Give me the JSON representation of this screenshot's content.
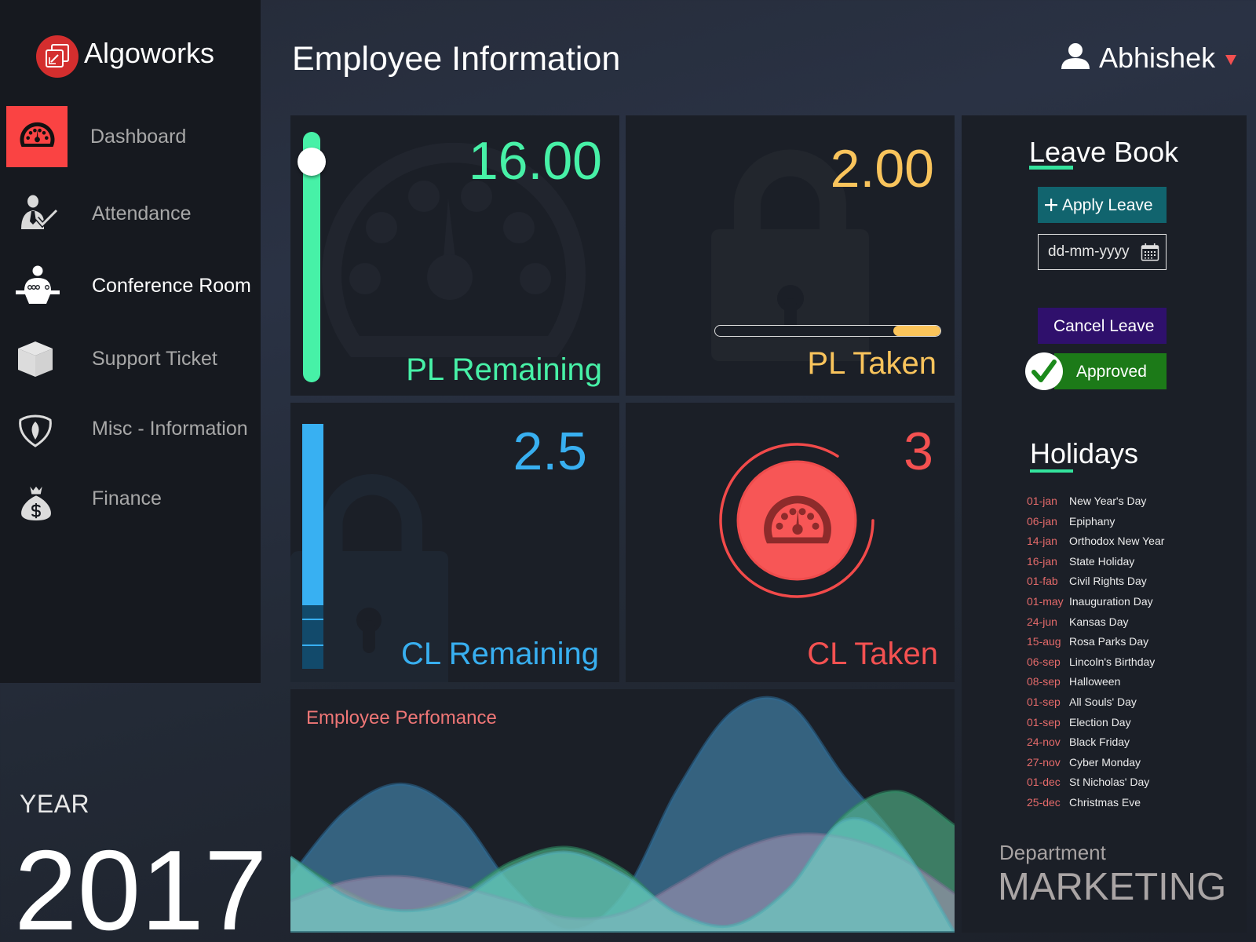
{
  "app": {
    "brand_name": "Algoworks",
    "logo_icon": "algoworks-logo-icon",
    "page_title": "Employee Information"
  },
  "user": {
    "name": "Abhishek",
    "icon": "user-icon",
    "menu_icon": "caret-down-icon"
  },
  "sidebar": {
    "items": [
      {
        "label": "Dashboard",
        "icon": "dashboard-gauge-icon",
        "state": "active"
      },
      {
        "label": "Attendance",
        "icon": "attendance-check-icon",
        "state": "default"
      },
      {
        "label": "Conference Room",
        "icon": "conference-podium-icon",
        "state": "highlighted"
      },
      {
        "label": "Support Ticket",
        "icon": "cube-icon",
        "state": "default"
      },
      {
        "label": "Misc - Information",
        "icon": "shield-leaf-icon",
        "state": "default"
      },
      {
        "label": "Finance",
        "icon": "money-bag-icon",
        "state": "default"
      }
    ]
  },
  "year": {
    "label": "YEAR",
    "value": "2017"
  },
  "stats": {
    "pl_remaining": {
      "value": "16.00",
      "label": "PL Remaining",
      "color": "#47f1a7",
      "background_icon": "gauge-icon",
      "slider_fraction": 0.88
    },
    "pl_taken": {
      "value": "2.00",
      "label": "PL Taken",
      "color": "#f9c45c",
      "background_icon": "lock-icon",
      "progress_fraction": 0.21
    },
    "cl_remaining": {
      "value": "2.5",
      "label": "CL Remaining",
      "color": "#38aff0",
      "background_icon": "lock-icon",
      "bar_fill_fraction": 0.74
    },
    "cl_taken": {
      "value": "3",
      "label": "CL Taken",
      "color": "#f45151",
      "icon": "gauge-icon",
      "ring_fraction": 0.84
    }
  },
  "leave_book": {
    "title": "Leave Book",
    "apply_button": {
      "icon": "plus-icon",
      "label": "Apply Leave",
      "color": "#11646e"
    },
    "date_input": {
      "value": "",
      "placeholder": "dd-mm-yyyy",
      "icon": "calendar-icon"
    },
    "cancel_button": {
      "label": "Cancel Leave",
      "color": "#2f106c"
    },
    "status": {
      "icon": "check-circle-icon",
      "label": "Approved",
      "color": "#1c7a18"
    }
  },
  "holidays": {
    "title": "Holidays",
    "items": [
      {
        "date": "01-jan",
        "name": "New Year's Day"
      },
      {
        "date": "06-jan",
        "name": "Epiphany"
      },
      {
        "date": "14-jan",
        "name": "Orthodox New Year"
      },
      {
        "date": "16-jan",
        "name": "State Holiday"
      },
      {
        "date": "01-fab",
        "name": "Civil Rights Day"
      },
      {
        "date": "01-may",
        "name": "Inauguration Day"
      },
      {
        "date": "24-jun",
        "name": "Kansas Day"
      },
      {
        "date": "15-aug",
        "name": "Rosa Parks Day"
      },
      {
        "date": "06-sep",
        "name": "Lincoln's Birthday"
      },
      {
        "date": "08-sep",
        "name": "Halloween"
      },
      {
        "date": "01-sep",
        "name": "All Souls' Day"
      },
      {
        "date": "01-sep",
        "name": "Election Day"
      },
      {
        "date": "24-nov",
        "name": "Black Friday"
      },
      {
        "date": "27-nov",
        "name": "Cyber Monday"
      },
      {
        "date": "01-dec",
        "name": "St Nicholas' Day"
      },
      {
        "date": "25-dec",
        "name": "Christmas Eve"
      }
    ]
  },
  "department": {
    "label": "Department",
    "value": "MARKETING"
  },
  "theme": {
    "accent_red": "#fa4343",
    "logo_red": "#d42e2e",
    "title_underline": "#34e39d",
    "holiday_date_color": "#e46a6a",
    "card_background": "#1b1f27",
    "sidebar_background": "#16191f"
  },
  "chart_data": {
    "type": "area",
    "title": "Employee Perfomance",
    "xlabel": "",
    "ylabel": "",
    "x": [
      0,
      1,
      2,
      3,
      4,
      5,
      6,
      7,
      8,
      9,
      10,
      11,
      12
    ],
    "xlim": [
      0,
      12
    ],
    "ylim": [
      0,
      100
    ],
    "grid": false,
    "legend": "none",
    "series": [
      {
        "color": "#488fba",
        "line_color": "#2c6a95",
        "values": [
          23,
          50,
          61,
          49,
          19,
          1,
          15,
          59,
          91,
          94,
          64,
          37,
          0
        ]
      },
      {
        "color": "#55bc8d",
        "line_color": "#2e8a63",
        "values": [
          31,
          17,
          9,
          15,
          29,
          35,
          26,
          7,
          3,
          18,
          48,
          58,
          44
        ]
      },
      {
        "color": "#a596b4",
        "line_color": "#776f90",
        "values": [
          13,
          21,
          23,
          19,
          13,
          6,
          8,
          20,
          33,
          40,
          39,
          31,
          16
        ]
      },
      {
        "color": "#67cbc5",
        "line_color": "#4fa9b2",
        "values": [
          31,
          15,
          9,
          13,
          27,
          33,
          24,
          8,
          3,
          18,
          46,
          36,
          0
        ]
      }
    ]
  }
}
